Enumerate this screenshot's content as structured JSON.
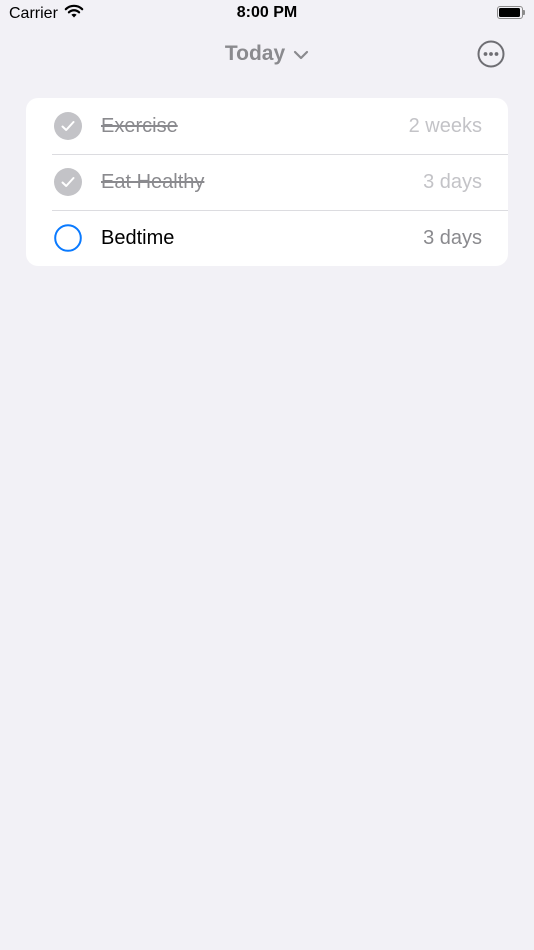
{
  "status_bar": {
    "carrier": "Carrier",
    "time": "8:00 PM"
  },
  "nav": {
    "title": "Today",
    "more_icon": "ellipsis-circle-icon"
  },
  "colors": {
    "accent": "#0a7aff",
    "completed_check": "#c3c3c7",
    "background": "#f2f1f6"
  },
  "habits": [
    {
      "label": "Exercise",
      "value": "2 weeks",
      "completed": true
    },
    {
      "label": "Eat Healthy",
      "value": "3 days",
      "completed": true
    },
    {
      "label": "Bedtime",
      "value": "3 days",
      "completed": false
    }
  ]
}
